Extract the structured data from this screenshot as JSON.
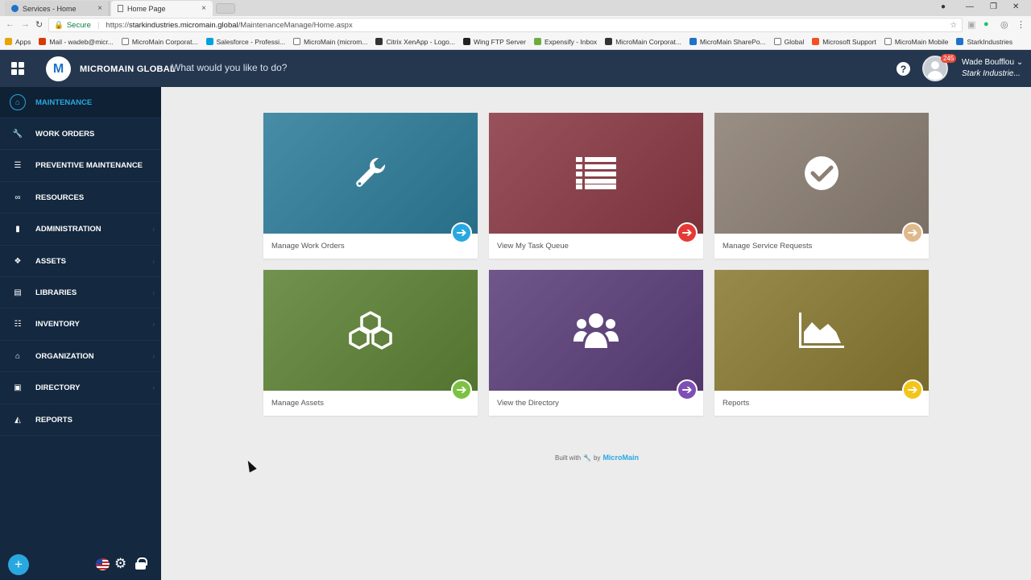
{
  "browser": {
    "tabs": [
      {
        "title": "Services - Home",
        "active": false
      },
      {
        "title": "Home Page",
        "active": true
      }
    ],
    "secure_label": "Secure",
    "url_prefix": "https://",
    "url_host": "starkindustries.micromain.global",
    "url_path": "/MaintenanceManage/Home.aspx",
    "bookmarks": [
      {
        "label": "Apps",
        "icon": "apps-grid-icon"
      },
      {
        "label": "Mail - wadeb@micr...",
        "icon": "office-icon"
      },
      {
        "label": "MicroMain Corporat...",
        "icon": "doc-icon"
      },
      {
        "label": "Salesforce - Professi...",
        "icon": "salesforce-icon"
      },
      {
        "label": "MicroMain (microm...",
        "icon": "doc-icon"
      },
      {
        "label": "Citrix XenApp - Logo...",
        "icon": "citrix-icon"
      },
      {
        "label": "Wing FTP Server",
        "icon": "wing-icon"
      },
      {
        "label": "Expensify - Inbox",
        "icon": "expensify-icon"
      },
      {
        "label": "MicroMain Corporat...",
        "icon": "micromain-icon"
      },
      {
        "label": "MicroMain SharePo...",
        "icon": "sharepoint-icon"
      },
      {
        "label": "Global",
        "icon": "doc-icon"
      },
      {
        "label": "Microsoft Support",
        "icon": "microsoft-icon"
      },
      {
        "label": "MicroMain Mobile",
        "icon": "doc-icon"
      },
      {
        "label": "StarkIndustries",
        "icon": "m-icon"
      }
    ]
  },
  "header": {
    "logo_letter": "M",
    "brand": "MICROMAIN GLOBAL",
    "command_placeholder": "What would you like to do?",
    "help": "?",
    "notifications": "245",
    "user_name": "Wade Boufflou ⌄",
    "user_company": "Stark Industrie..."
  },
  "sidebar": {
    "items": [
      {
        "label": "MAINTENANCE",
        "icon": "home-icon",
        "glyph": "⌂",
        "active": true,
        "chevron": false
      },
      {
        "label": "WORK ORDERS",
        "icon": "wrench-icon",
        "glyph": "🔧",
        "active": false,
        "chevron": false
      },
      {
        "label": "PREVENTIVE MAINTENANCE",
        "icon": "sliders-icon",
        "glyph": "☰",
        "active": false,
        "chevron": false
      },
      {
        "label": "RESOURCES",
        "icon": "link-icon",
        "glyph": "∞",
        "active": false,
        "chevron": false
      },
      {
        "label": "ADMINISTRATION",
        "icon": "bookmark-icon",
        "glyph": "▮",
        "active": false,
        "chevron": true
      },
      {
        "label": "ASSETS",
        "icon": "cubes-icon",
        "glyph": "❖",
        "active": false,
        "chevron": true
      },
      {
        "label": "LIBRARIES",
        "icon": "archive-icon",
        "glyph": "▤",
        "active": false,
        "chevron": true
      },
      {
        "label": "INVENTORY",
        "icon": "list-icon",
        "glyph": "☷",
        "active": false,
        "chevron": true
      },
      {
        "label": "ORGANIZATION",
        "icon": "bank-icon",
        "glyph": "⌂",
        "active": false,
        "chevron": true
      },
      {
        "label": "DIRECTORY",
        "icon": "book-icon",
        "glyph": "▣",
        "active": false,
        "chevron": true
      },
      {
        "label": "REPORTS",
        "icon": "area-chart-icon",
        "glyph": "◭",
        "active": false,
        "chevron": false
      }
    ],
    "chevron_glyph": "›",
    "add_label": "+",
    "gear_glyph": "⚙"
  },
  "cards": [
    {
      "label": "Manage Work Orders",
      "icon": "wrench-icon",
      "color": "#2e7d9a",
      "arrow_color": "#29a8e0"
    },
    {
      "label": "View  My Task Queue",
      "icon": "list-icon",
      "color": "#8b3a45",
      "arrow_color": "#e53935"
    },
    {
      "label": "Manage Service Requests",
      "icon": "check-circle-icon",
      "color": "#8c7f74",
      "arrow_color": "#e0b98a"
    },
    {
      "label": "Manage Assets",
      "icon": "cubes-icon",
      "color": "#5e8436",
      "arrow_color": "#7cc242"
    },
    {
      "label": "View the Directory",
      "icon": "users-icon",
      "color": "#5c3f7a",
      "arrow_color": "#7e4fb5"
    },
    {
      "label": "Reports",
      "icon": "area-chart-icon",
      "color": "#8a7a32",
      "arrow_color": "#f3c518"
    }
  ],
  "card_arrow_glyph": "➔",
  "footer": {
    "built_with": "Built with",
    "by": "by",
    "brand": "MicroMain"
  }
}
